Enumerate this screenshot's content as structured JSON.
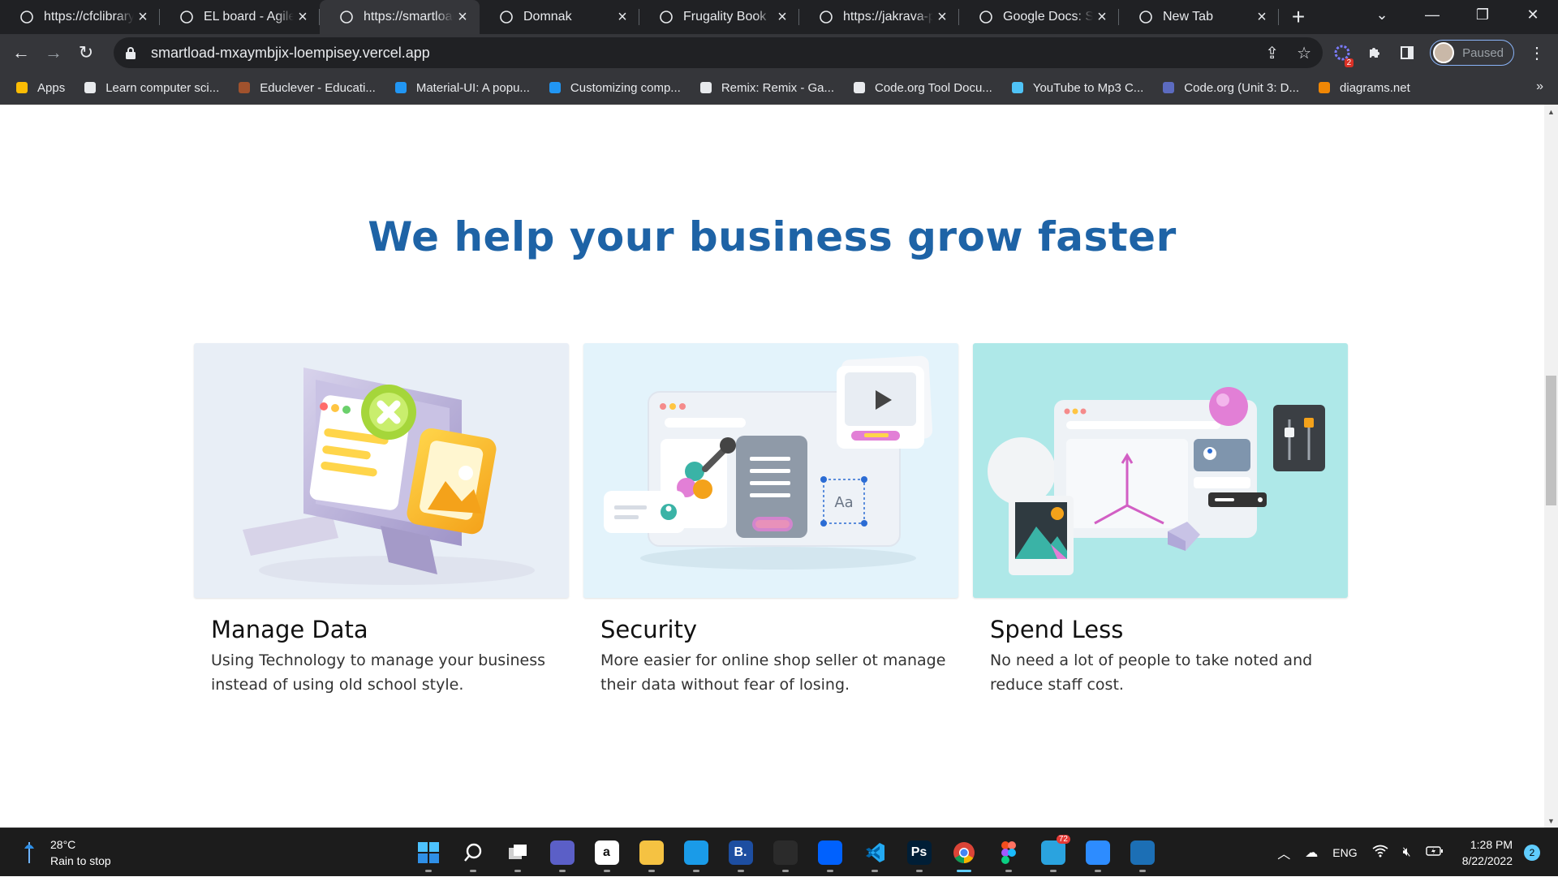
{
  "tabs": [
    {
      "title": "https://cfclibrary.w",
      "active": false
    },
    {
      "title": "EL board - Agile b",
      "active": false
    },
    {
      "title": "https://smartload",
      "active": true
    },
    {
      "title": "Domnak",
      "active": false
    },
    {
      "title": "Frugality Book",
      "active": false
    },
    {
      "title": "https://jakrava-pl",
      "active": false
    },
    {
      "title": "Google Docs: Sign",
      "active": false
    },
    {
      "title": "New Tab",
      "active": false
    }
  ],
  "address": {
    "url": "smartload-mxaymbjix-loempisey.vercel.app"
  },
  "profile": {
    "status": "Paused"
  },
  "extensions": {
    "badge": "2"
  },
  "bookmarks": [
    {
      "label": "Apps",
      "icon": "apps-grid-icon",
      "color": "#fbbc04"
    },
    {
      "label": "Learn computer sci...",
      "icon": "code-grid-icon",
      "color": "#e8eaed"
    },
    {
      "label": "Educlever - Educati...",
      "icon": "book-icon",
      "color": "#a0522d"
    },
    {
      "label": "Material-UI: A popu...",
      "icon": "mui-icon",
      "color": "#2196f3"
    },
    {
      "label": "Customizing comp...",
      "icon": "mui-icon",
      "color": "#2196f3"
    },
    {
      "label": "Remix: Remix - Ga...",
      "icon": "code-grid-icon",
      "color": "#e8eaed"
    },
    {
      "label": "Code.org Tool Docu...",
      "icon": "grid-icon",
      "color": "#e8eaed"
    },
    {
      "label": "YouTube to Mp3 C...",
      "icon": "cloud-download-icon",
      "color": "#4fc3f7"
    },
    {
      "label": "Code.org (Unit 3: D...",
      "icon": "q-icon",
      "color": "#5c6bc0"
    },
    {
      "label": "diagrams.net",
      "icon": "diagrams-icon",
      "color": "#f08705"
    }
  ],
  "page": {
    "headline": "We help your business grow faster",
    "headline_color": "#1e63a6",
    "cards": [
      {
        "title": "Manage Data",
        "description": "Using Technology to manage your business instead of using old school style.",
        "bg": "#e8eef6"
      },
      {
        "title": "Security",
        "description": "More easier for online shop seller ot manage their data without fear of losing.",
        "bg": "#e3f3fb",
        "illustration_text": "Aa"
      },
      {
        "title": "Spend Less",
        "description": "No need a lot of people to take noted and reduce staff cost.",
        "bg": "#aee8e8"
      }
    ]
  },
  "taskbar": {
    "weather": {
      "temp": "28°C",
      "desc": "Rain to stop"
    },
    "apps": [
      {
        "name": "start",
        "label": "",
        "color": "#2f8fe6"
      },
      {
        "name": "search",
        "label": "",
        "color": "#1c1c1c"
      },
      {
        "name": "task-view",
        "label": "",
        "color": "#1c1c1c"
      },
      {
        "name": "teams-chat",
        "label": "",
        "color": "#5b5fc7"
      },
      {
        "name": "amazon",
        "label": "a",
        "color": "#ffffff"
      },
      {
        "name": "file-explorer",
        "label": "",
        "color": "#f5c242"
      },
      {
        "name": "edge",
        "label": "",
        "color": "#1a9be8"
      },
      {
        "name": "booking",
        "label": "B.",
        "color": "#1d4ea1"
      },
      {
        "name": "store",
        "label": "",
        "color": "#2b2b2b"
      },
      {
        "name": "dropbox",
        "label": "",
        "color": "#0061fe"
      },
      {
        "name": "vscode",
        "label": "",
        "color": "#1c1c1c"
      },
      {
        "name": "photoshop",
        "label": "Ps",
        "color": "#001e36"
      },
      {
        "name": "chrome",
        "label": "",
        "color": "#1c1c1c"
      },
      {
        "name": "figma",
        "label": "",
        "color": "#1c1c1c"
      },
      {
        "name": "telegram",
        "label": "",
        "color": "#2aa3df",
        "badge": "72"
      },
      {
        "name": "zoom",
        "label": "",
        "color": "#2d8cff"
      },
      {
        "name": "photos",
        "label": "",
        "color": "#1c6fb5"
      }
    ],
    "language": "ENG",
    "time": "1:28 PM",
    "date": "8/22/2022",
    "notifications": "2"
  }
}
